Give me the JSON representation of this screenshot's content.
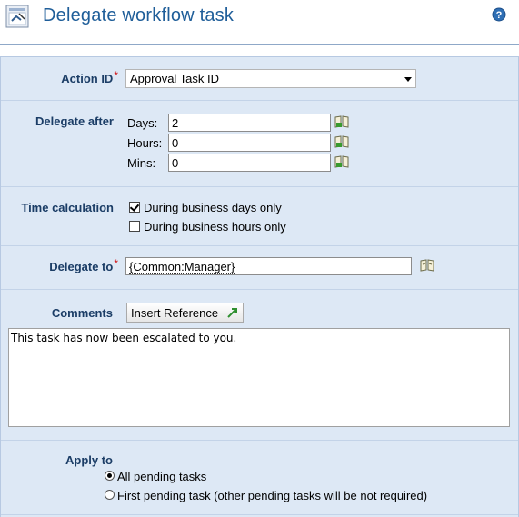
{
  "header": {
    "title": "Delegate workflow task",
    "icon": "workflow-task-icon",
    "help_icon": "help-icon"
  },
  "form": {
    "action_id": {
      "label": "Action ID",
      "required_marker": "*",
      "selected": "Approval Task ID"
    },
    "delegate_after": {
      "label": "Delegate after",
      "days_label": "Days:",
      "days_value": "2",
      "hours_label": "Hours:",
      "hours_value": "0",
      "mins_label": "Mins:",
      "mins_value": "0"
    },
    "time_calculation": {
      "label": "Time calculation",
      "options": [
        {
          "label": "During business days only",
          "checked": true
        },
        {
          "label": "During business hours only",
          "checked": false
        }
      ]
    },
    "delegate_to": {
      "label": "Delegate to",
      "required_marker": "*",
      "value": "{Common:Manager}"
    },
    "comments": {
      "label": "Comments",
      "insert_reference_label": "Insert Reference",
      "text": "This task has now been escalated to you."
    },
    "apply_to": {
      "label": "Apply to",
      "options": [
        {
          "label": "All pending tasks",
          "selected": true
        },
        {
          "label": "First pending task (other pending tasks will be not required)",
          "selected": false
        }
      ]
    }
  },
  "colors": {
    "title": "#1f5e99",
    "label": "#1b3d66",
    "panel": "#dde8f5",
    "required": "#d21010"
  }
}
